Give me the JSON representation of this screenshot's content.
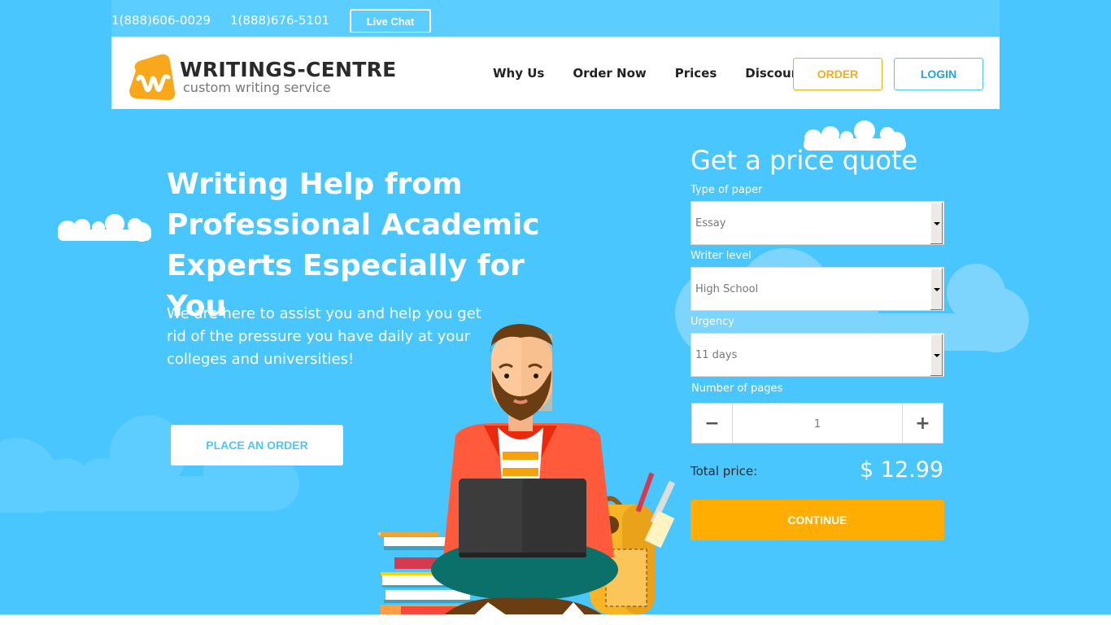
{
  "topbar": {
    "phones": [
      "1(888)606-0029",
      "1(888)676-5101"
    ],
    "live_chat_label": "Live Chat"
  },
  "header": {
    "logo": {
      "name": "WRITINGS-CENTRE",
      "tagline": "custom writing service",
      "icon": "w-triangle-logo-icon"
    },
    "nav": [
      "Why Us",
      "Order Now",
      "Prices",
      "Discounts"
    ],
    "order_label": "ORDER",
    "login_label": "LOGIN"
  },
  "hero": {
    "title_lines": [
      "Writing Help from",
      "Professional Academic",
      "Experts Especially for You"
    ],
    "subtitle_lines": [
      "We are here to assist you and help you get",
      "rid of the pressure you have daily at your",
      "colleges and universities!"
    ],
    "cta_label": "PLACE AN ORDER",
    "illustration": "student-with-laptop-illustration"
  },
  "quote": {
    "title": "Get a price quote",
    "paper_type": {
      "label": "Type of paper",
      "value": "Essay"
    },
    "writer_level": {
      "label": "Writer level",
      "value": "High School"
    },
    "urgency": {
      "label": "Urgency",
      "value": "11 days"
    },
    "pages": {
      "label": "Number of pages",
      "value": "1",
      "minus": "−",
      "plus": "+"
    },
    "total_label": "Total price:",
    "total_value": "$ 12.99",
    "continue_label": "CONTINUE"
  },
  "colors": {
    "background": "#4ac6fe",
    "accent_orange": "#ffad00",
    "order_orange": "#f4ad1b",
    "login_blue": "#1ea5e8"
  }
}
